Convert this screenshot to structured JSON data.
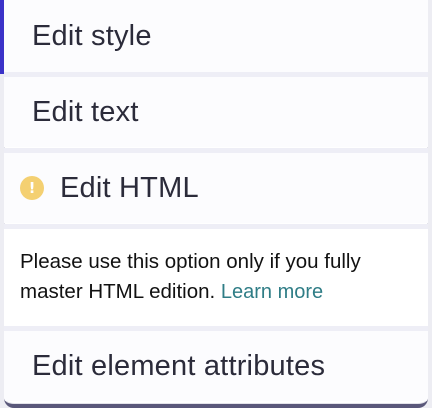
{
  "menu": {
    "items": [
      {
        "label": "Edit style"
      },
      {
        "label": "Edit text"
      },
      {
        "label": "Edit HTML",
        "icon": "warning-icon",
        "icon_glyph": "!"
      },
      {
        "label": "Edit element attributes"
      }
    ],
    "note": {
      "text": "Please use this option only if you fully master HTML edition.",
      "link": "Learn more"
    }
  },
  "colors": {
    "accent": "#3b32c8",
    "warning": "#f4d072",
    "link": "#2f7d86"
  }
}
